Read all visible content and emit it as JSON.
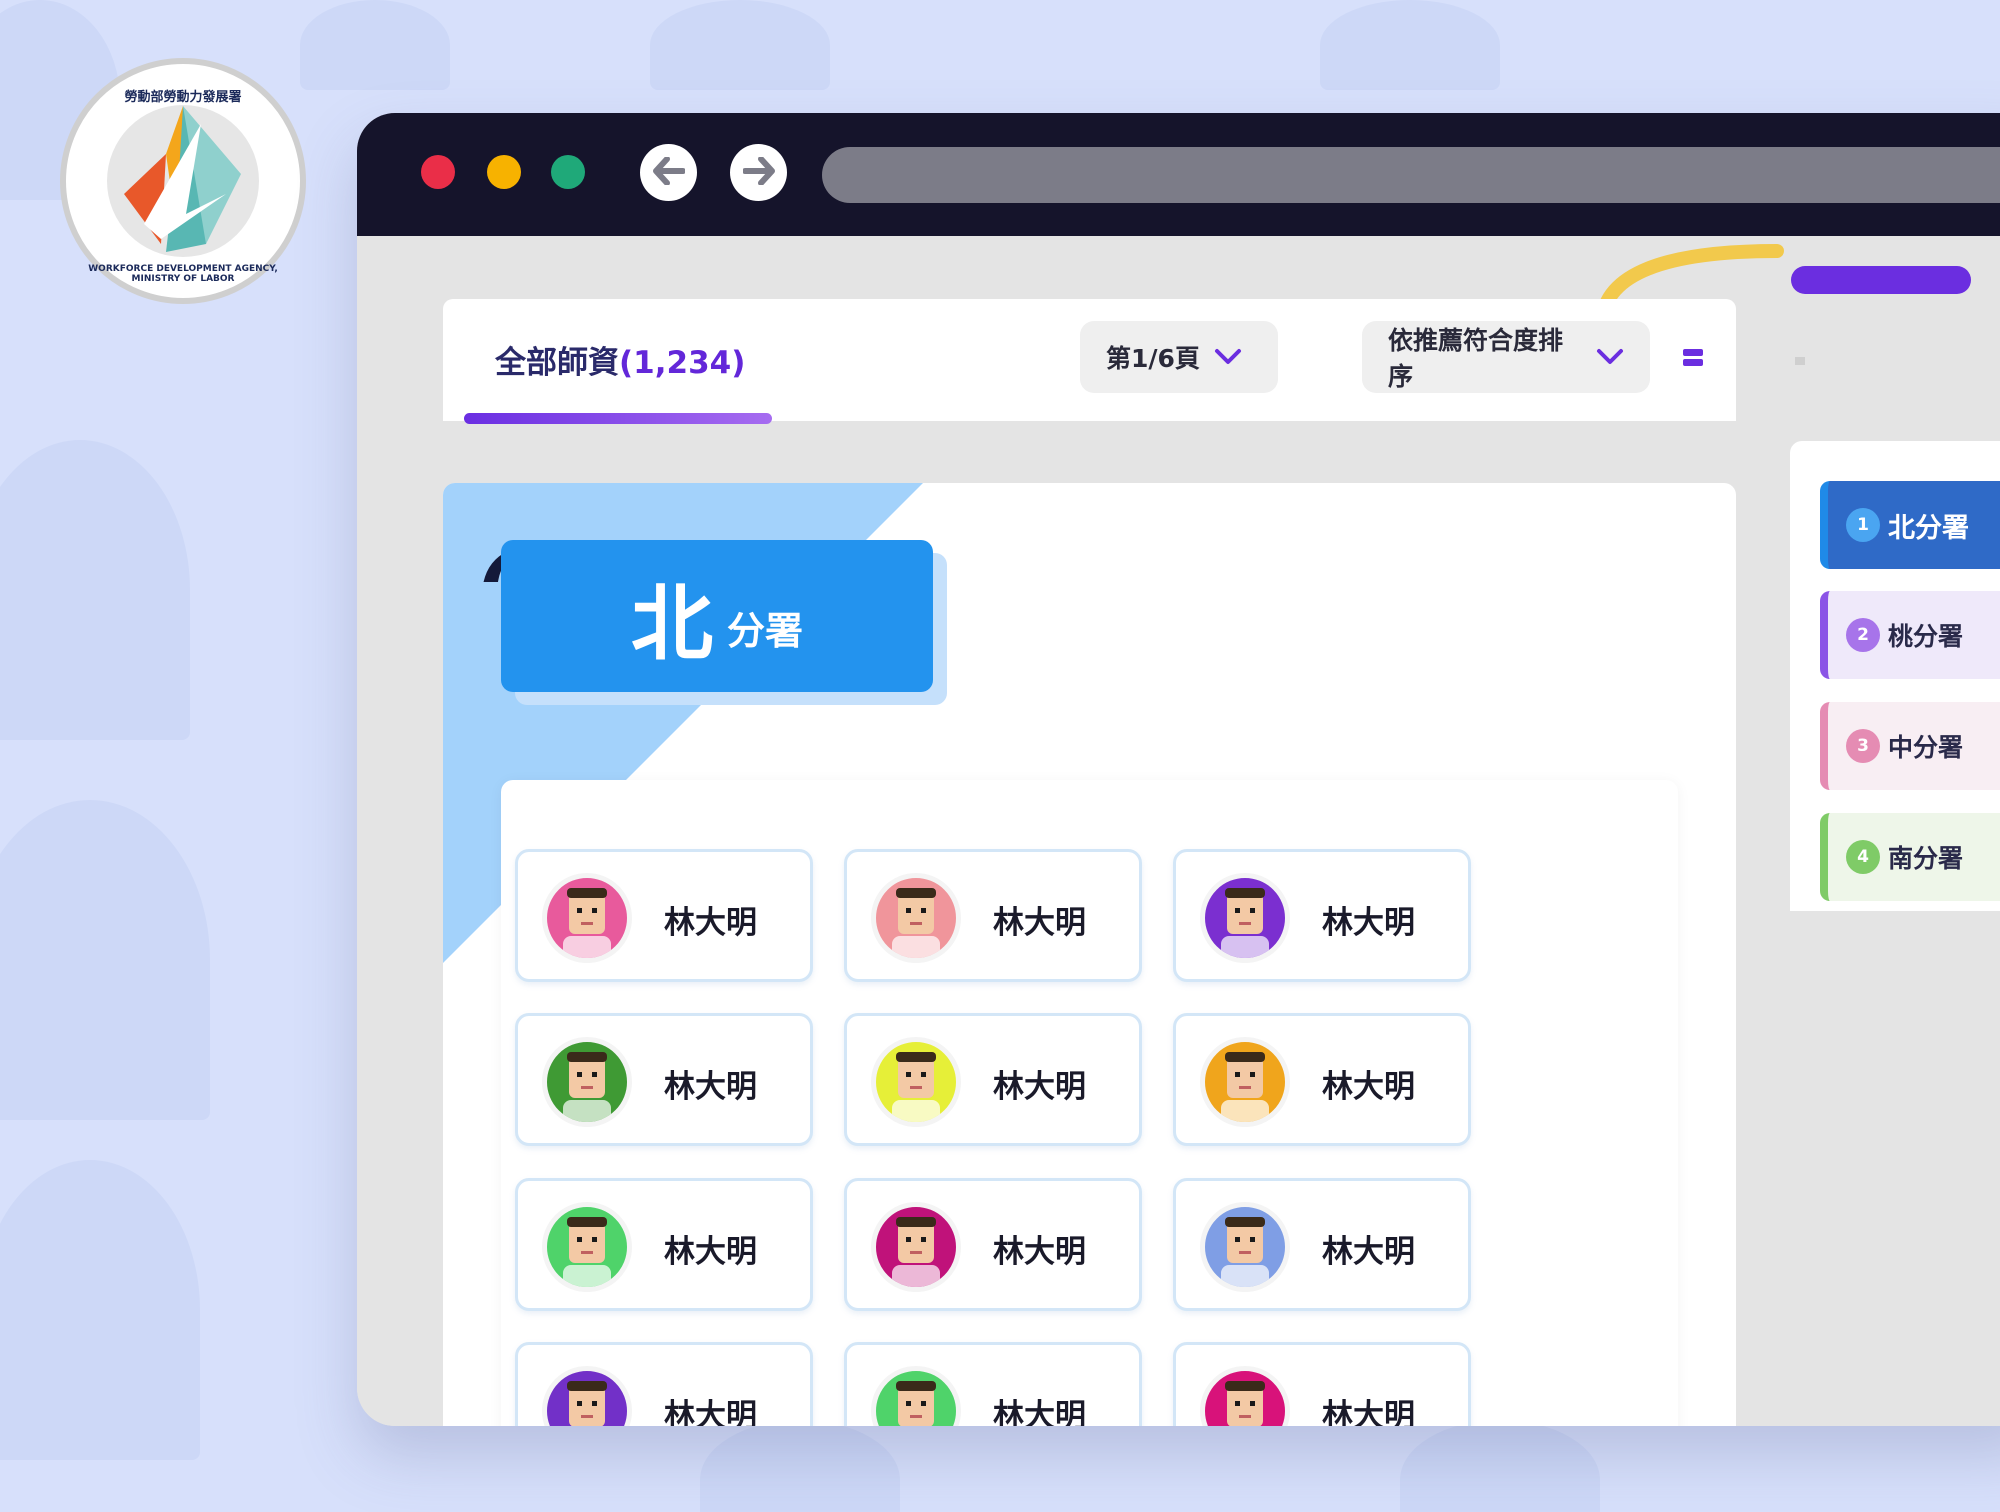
{
  "seal": {
    "chinese_name": "勞動部勞動力發展署",
    "english_name": "WORKFORCE DEVELOPMENT AGENCY, MINISTRY OF LABOR"
  },
  "tabs": {
    "all_label": "全部師資",
    "all_count": "(1,234)"
  },
  "pagination": {
    "label": "第1/6頁"
  },
  "sort": {
    "label": "依推薦符合度排序"
  },
  "branch_header": {
    "big": "北",
    "small": "分署"
  },
  "teachers": [
    {
      "name": "林大明",
      "color": "#e85a9c"
    },
    {
      "name": "林大明",
      "color": "#f0959b"
    },
    {
      "name": "林大明",
      "color": "#7b2fd0"
    },
    {
      "name": "林大明",
      "color": "#3f9a34"
    },
    {
      "name": "林大明",
      "color": "#e6ef38"
    },
    {
      "name": "林大明",
      "color": "#f0a51c"
    },
    {
      "name": "林大明",
      "color": "#4fd36a"
    },
    {
      "name": "林大明",
      "color": "#c0127a"
    },
    {
      "name": "林大明",
      "color": "#7f9ee5"
    },
    {
      "name": "林大明",
      "color": "#7230c8"
    },
    {
      "name": "林大明",
      "color": "#4fd36a"
    },
    {
      "name": "林大明",
      "color": "#d8127a"
    }
  ],
  "branch_nav": [
    {
      "num": "1",
      "label": "北分署"
    },
    {
      "num": "2",
      "label": "桃分署"
    },
    {
      "num": "3",
      "label": "中分署"
    },
    {
      "num": "4",
      "label": "南分署"
    }
  ]
}
